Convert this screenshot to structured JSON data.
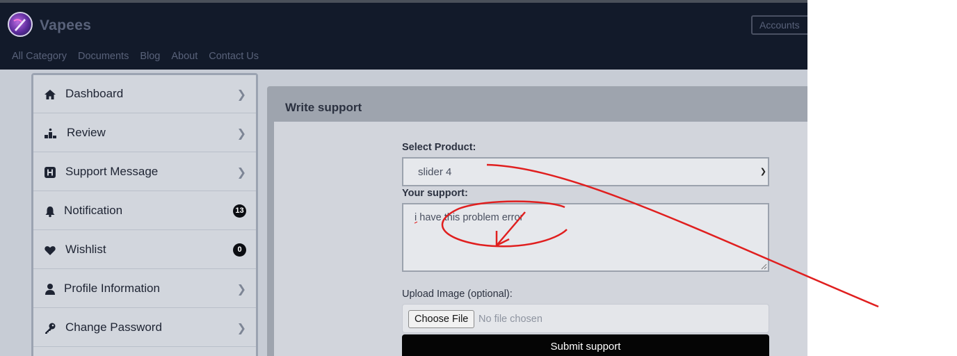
{
  "header": {
    "brand": "Vapees",
    "accounts_label": "Accounts",
    "nav": [
      "All Category",
      "Documents",
      "Blog",
      "About",
      "Contact Us"
    ]
  },
  "sidebar": {
    "items": [
      {
        "label": "Dashboard",
        "icon": "home-icon",
        "trail": "chevron"
      },
      {
        "label": "Review",
        "icon": "podium-icon",
        "trail": "chevron"
      },
      {
        "label": "Support Message",
        "icon": "h-square-icon",
        "trail": "chevron"
      },
      {
        "label": "Notification",
        "icon": "bell-icon",
        "badge": "13"
      },
      {
        "label": "Wishlist",
        "icon": "heart-icon",
        "badge": "0"
      },
      {
        "label": "Profile Information",
        "icon": "user-icon",
        "trail": "chevron"
      },
      {
        "label": "Change Password",
        "icon": "key-icon",
        "trail": "chevron"
      }
    ]
  },
  "form": {
    "title": "Write support",
    "product_label": "Select Product:",
    "product_value": "slider 4",
    "support_label": "Your support:",
    "support_value": "i have this problem error",
    "upload_label": "Upload Image (optional):",
    "choose_file_label": "Choose File",
    "no_file_text": "No file chosen",
    "submit_label": "Submit support"
  },
  "colors": {
    "header_bg": "#121a2a",
    "annotation": "#e01f1f",
    "submit_bg": "#050505"
  }
}
